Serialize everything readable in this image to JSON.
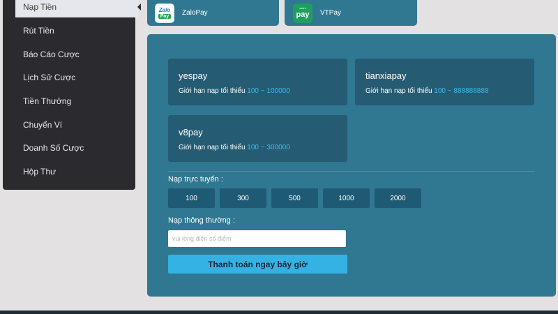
{
  "sidebar": {
    "items": [
      {
        "label": "Nạp Tiền",
        "active": true
      },
      {
        "label": "Rút Tiền"
      },
      {
        "label": "Báo Cáo Cược"
      },
      {
        "label": "Lịch Sử Cược"
      },
      {
        "label": "Tiền Thưởng"
      },
      {
        "label": "Chuyển Ví"
      },
      {
        "label": "Doanh Số Cược"
      },
      {
        "label": "Hộp Thư"
      }
    ]
  },
  "wallets": [
    {
      "name": "ZaloPay",
      "logo_text_top": "Zalo",
      "logo_text_bottom": "Pay"
    },
    {
      "name": "VTPay",
      "logo_text": "pay"
    }
  ],
  "channels": [
    {
      "name": "yespay",
      "limit_label": "Giới hạn nạp tối thiểu",
      "min": "100",
      "sep": "~",
      "max": "100000"
    },
    {
      "name": "tianxiapay",
      "limit_label": "Giới hạn nạp tối thiểu",
      "min": "100",
      "sep": "~",
      "max": "888888888"
    },
    {
      "name": "v8pay",
      "limit_label": "Giới hạn nạp tối thiểu",
      "min": "100",
      "sep": "~",
      "max": "300000"
    }
  ],
  "online": {
    "label": "Nạp trực tuyến :",
    "amounts": [
      "100",
      "300",
      "500",
      "1000",
      "2000"
    ]
  },
  "normal": {
    "label": "Nạp thông thường :",
    "placeholder": "vui lòng điền số điểm",
    "value": ""
  },
  "submit_label": "Thanh toán ngay bây giờ",
  "colors": {
    "sidebar_bg": "#2b2b2f",
    "panel_bg": "#307791",
    "card_bg": "#255c73",
    "accent": "#35b2e4",
    "limit_number": "#3fb9ea"
  }
}
